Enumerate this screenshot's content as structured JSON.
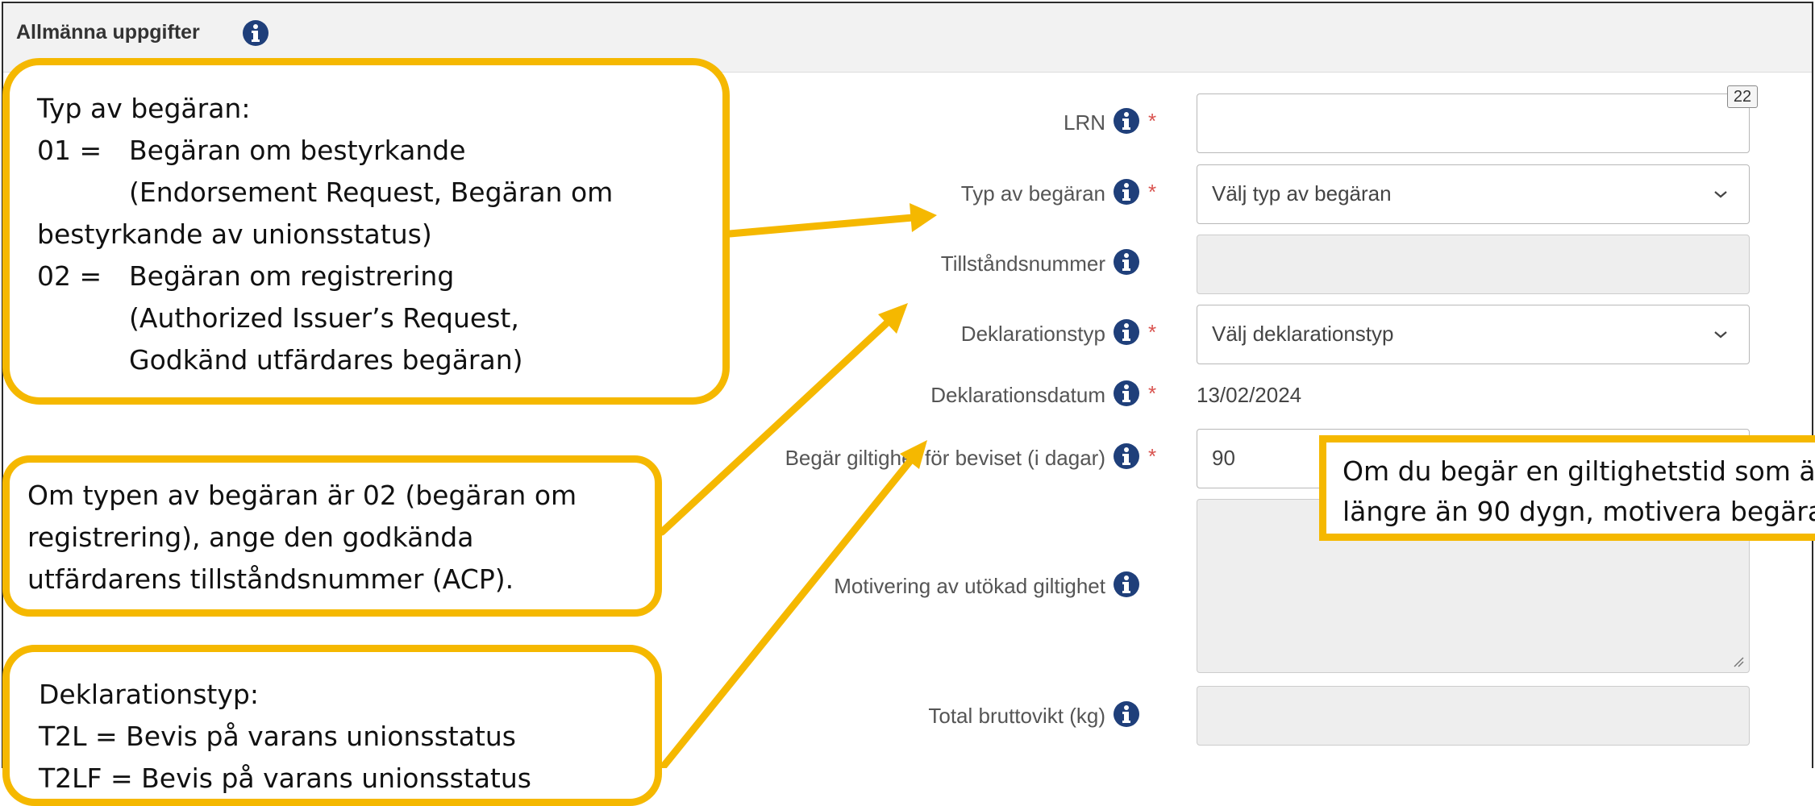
{
  "section": {
    "title": "Allmänna uppgifter"
  },
  "icons": {
    "info": "info-circle-icon",
    "chevron": "chevron-down-icon",
    "resize": "resize-handle-icon"
  },
  "colors": {
    "accent": "#f5b800",
    "info": "#1f3f7a",
    "required": "#d9534f",
    "disabled": "#eeeeee"
  },
  "form": {
    "lrn": {
      "label": "LRN",
      "counter": "22",
      "value": ""
    },
    "request_type": {
      "label": "Typ av begäran",
      "selected": "Välj typ av begäran"
    },
    "permit_number": {
      "label": "Tillståndsnummer",
      "value": ""
    },
    "declaration_type": {
      "label": "Deklarationstyp",
      "selected": "Välj deklarationstyp"
    },
    "declaration_date": {
      "label": "Deklarationsdatum",
      "value": "13/02/2024"
    },
    "validity": {
      "label": "Begär giltighet för beviset (i dagar)",
      "value": "90"
    },
    "motivation": {
      "label": "Motivering av utökad giltighet",
      "value": ""
    },
    "gross_weight": {
      "label": "Total bruttovikt (kg)",
      "value": ""
    },
    "required_marker": "*"
  },
  "callouts": {
    "request_type": {
      "lines": [
        "Typ av begäran:",
        "01 =",
        "Begäran om bestyrkande",
        "(Endorsement Request, Begäran om",
        "bestyrkande av unionsstatus)",
        "02 =",
        "Begäran om registrering",
        "(Authorized Issuer’s Request,",
        "Godkänd utfärdares begäran)"
      ]
    },
    "permit": {
      "lines": [
        "Om typen av begäran är 02 (begäran om",
        "registrering), ange den godkända",
        "utfärdarens tillståndsnummer (ACP)."
      ]
    },
    "declaration_type": {
      "lines": [
        "Deklarationstyp:",
        "T2L = Bevis på varans unionsstatus",
        "T2LF = Bevis på varans unionsstatus"
      ]
    },
    "validity": {
      "lines": [
        "Om du begär en giltighetstid som ä",
        "längre än 90 dygn, motivera begära"
      ]
    }
  }
}
